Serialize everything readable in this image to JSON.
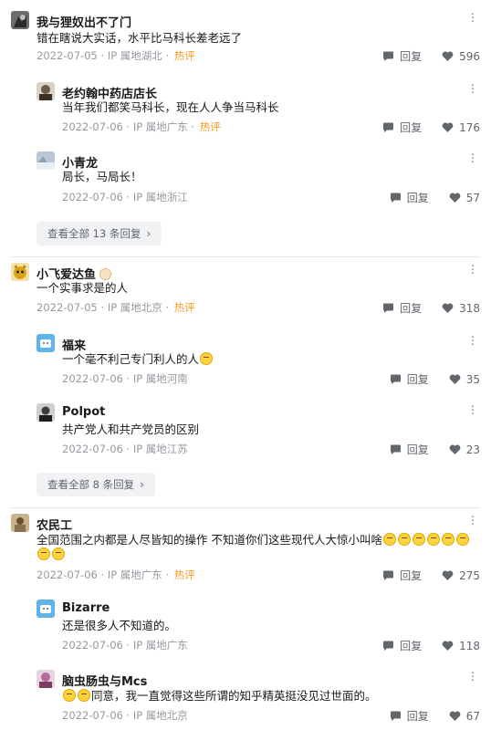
{
  "threads": [
    {
      "name": "我与狸奴出不了门",
      "text": "错在瞎说大实话，水平比马科长差老远了",
      "date": "2022-07-05",
      "ip": "IP 属地湖北",
      "hot": "热评",
      "reply_label": "回复",
      "likes": "596",
      "replies": [
        {
          "name": "老约翰中药店店长",
          "text": "当年我们都笑马科长，现在人人争当马科长",
          "date": "2022-07-06",
          "ip": "IP 属地广东",
          "hot": "热评",
          "reply_label": "回复",
          "likes": "176"
        },
        {
          "name": "小青龙",
          "text": "局长，马局长！",
          "date": "2022-07-06",
          "ip": "IP 属地浙江",
          "reply_label": "回复",
          "likes": "57"
        }
      ],
      "view_all": "查看全部 13 条回复"
    },
    {
      "name": "小飞爱达鱼",
      "text": "一个实事求是的人",
      "date": "2022-07-05",
      "ip": "IP 属地北京",
      "hot": "热评",
      "reply_label": "回复",
      "likes": "318",
      "replies": [
        {
          "name": "福来",
          "text": "一个毫不利己专门利人的人",
          "date": "2022-07-06",
          "ip": "IP 属地河南",
          "reply_label": "回复",
          "likes": "35"
        },
        {
          "name": "Polpot",
          "text": "共产党人和共产党员的区别",
          "date": "2022-07-06",
          "ip": "IP 属地江苏",
          "reply_label": "回复",
          "likes": "23"
        }
      ],
      "view_all": "查看全部 8 条回复"
    },
    {
      "name": "农民工",
      "text_line1": "全国范围之内都是人尽皆知的操作 不知道你们这些现代人大惊小叫啥",
      "date": "2022-07-06",
      "ip": "IP 属地广东",
      "hot": "热评",
      "reply_label": "回复",
      "likes": "275",
      "replies": [
        {
          "name": "Bizarre",
          "text": "还是很多人不知道的。",
          "date": "2022-07-06",
          "ip": "IP 属地广东",
          "reply_label": "回复",
          "likes": "118"
        },
        {
          "name": "脑虫肠虫与Mcs",
          "text": "同意，我一直觉得这些所谓的知乎精英挺没见过世面的。",
          "date": "2022-07-06",
          "ip": "IP 属地北京",
          "reply_label": "回复",
          "likes": "67"
        }
      ]
    }
  ],
  "more_label": "⋮",
  "sep": " · ",
  "colors": {
    "hot": "#ff9a1f",
    "meta": "#9499a0",
    "action": "#61666d",
    "name": "#18191c"
  },
  "icons": {
    "more": "more-dots-icon",
    "reply": "reply-bubble-icon",
    "like": "heart-icon",
    "chevron": "chevron-right-icon"
  }
}
